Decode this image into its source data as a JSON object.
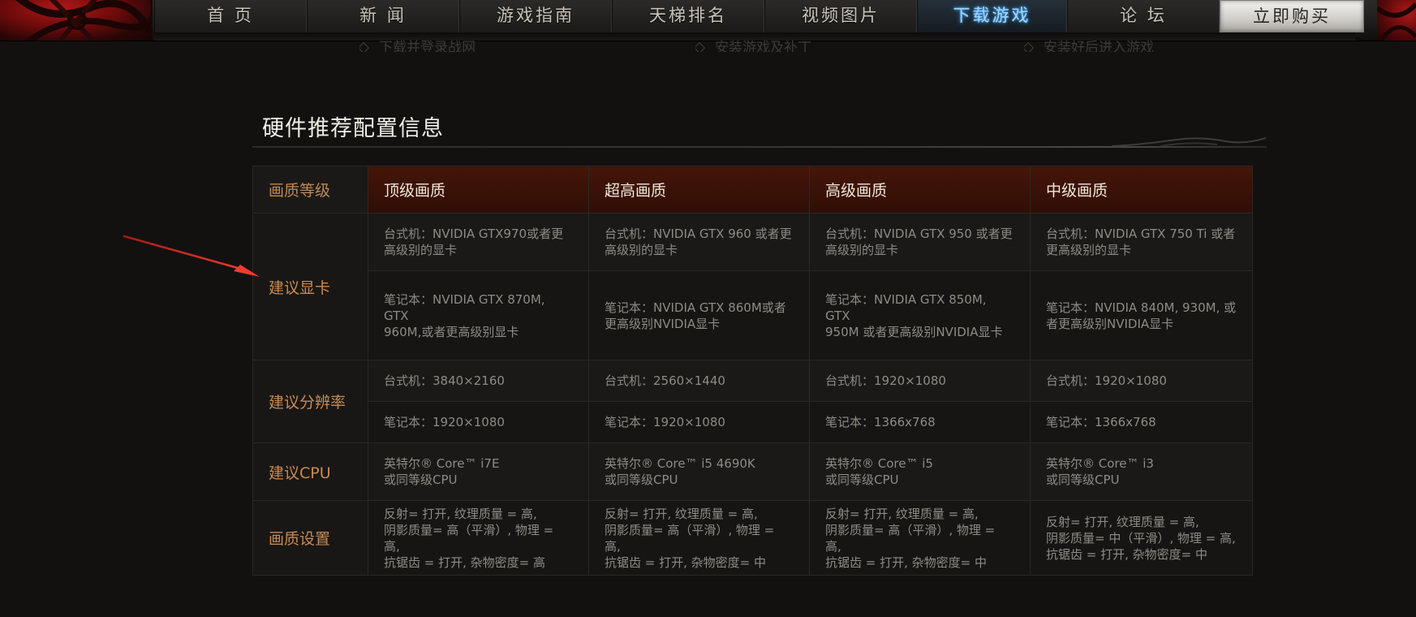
{
  "nav": {
    "items": [
      "首 页",
      "新 闻",
      "游戏指南",
      "天梯排名",
      "视频图片",
      "下载游戏",
      "论 坛"
    ],
    "active_index": 5,
    "buy_label": "立即购买",
    "accent_color": "#9fd6ff"
  },
  "faint_subnav": [
    "下载并登录战网",
    "安装游戏及补丁",
    "安装好后进入游戏"
  ],
  "section": {
    "title": "硬件推荐配置信息"
  },
  "table": {
    "header_label": "画质等级",
    "tiers": [
      "顶级画质",
      "超高画质",
      "高级画质",
      "中级画质"
    ],
    "rows": {
      "gpu": {
        "label": "建议显卡",
        "desktop": [
          "台式机：NVIDIA GTX970或者更\n高级别的显卡",
          "台式机：NVIDIA GTX 960 或者更\n高级别的显卡",
          "台式机：NVIDIA GTX 950 或者更\n高级别的显卡",
          "台式机：NVIDIA GTX 750 Ti 或者\n更高级别的显卡"
        ],
        "laptop": [
          "笔记本：NVIDIA GTX 870M, GTX\n960M,或者更高级别显卡",
          "笔记本：NVIDIA GTX 860M或者\n更高级别NVIDIA显卡",
          "笔记本：NVIDIA GTX 850M, GTX\n950M 或者更高级别NVIDIA显卡",
          "笔记本：NVIDIA 840M, 930M, 或\n者更高级别NVIDIA显卡"
        ]
      },
      "resolution": {
        "label": "建议分辨率",
        "desktop": [
          "台式机：3840×2160",
          "台式机：2560×1440",
          "台式机：1920×1080",
          "台式机：1920×1080"
        ],
        "laptop": [
          "笔记本：1920×1080",
          "笔记本：1920×1080",
          "笔记本：1366x768",
          "笔记本：1366x768"
        ]
      },
      "cpu": {
        "label": "建议CPU",
        "values": [
          "英特尔® Core™ i7E\n或同等级CPU",
          "英特尔® Core™ i5 4690K\n或同等级CPU",
          "英特尔® Core™ i5\n或同等级CPU",
          "英特尔® Core™ i3\n或同等级CPU"
        ]
      },
      "graphics": {
        "label": "画质设置",
        "values": [
          "反射= 打开, 纹理质量 = 高,\n阴影质量= 高（平滑）, 物理 = 高,\n抗锯齿 = 打开, 杂物密度= 高",
          "反射= 打开, 纹理质量 = 高,\n阴影质量= 高（平滑）, 物理 = 高,\n抗锯齿 = 打开, 杂物密度= 中",
          "反射= 打开, 纹理质量 = 高,\n阴影质量= 高（平滑）, 物理 = 高,\n抗锯齿 = 打开, 杂物密度= 中",
          "反射= 打开, 纹理质量 = 高,\n阴影质量= 中（平滑）, 物理 = 高,\n抗锯齿 = 打开, 杂物密度= 中"
        ]
      }
    }
  },
  "colors": {
    "background": "#121110",
    "header_tier_bg": "#451508",
    "label_text": "#c98a52",
    "cell_text": "#8f8a84",
    "annotation_arrow": "#e8362c"
  }
}
